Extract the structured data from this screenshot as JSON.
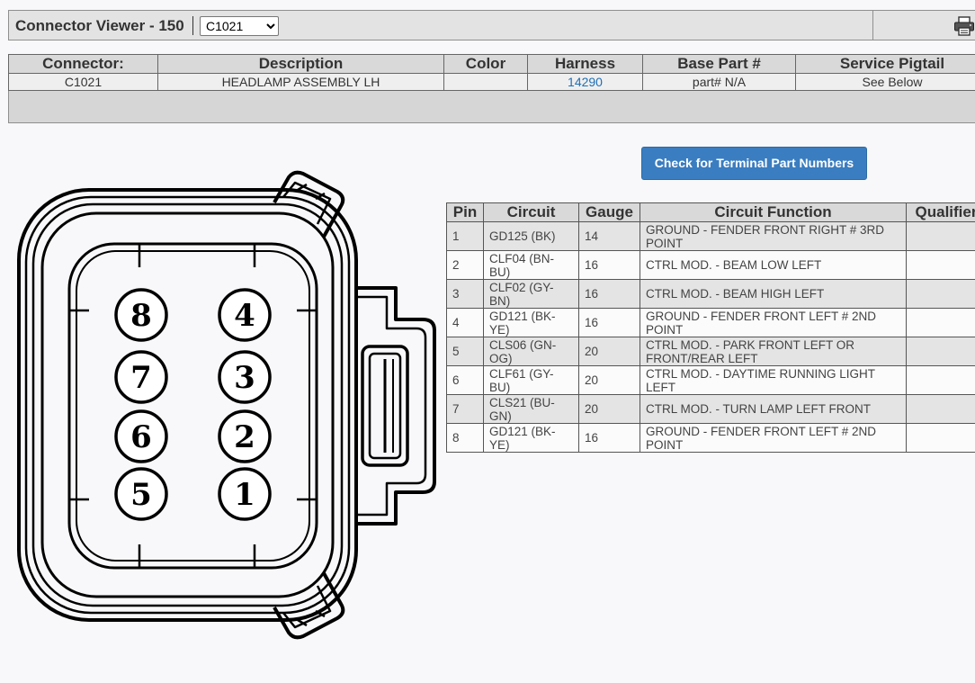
{
  "header": {
    "title": "Connector Viewer - 150",
    "connector_select": "C1021",
    "print_icon": "printer-icon"
  },
  "connector_table": {
    "headers": [
      "Connector:",
      "Description",
      "Color",
      "Harness",
      "Base Part #",
      "Service Pigtail"
    ],
    "row": {
      "connector": "C1021",
      "description": "HEADLAMP ASSEMBLY LH",
      "color": "",
      "harness": "14290",
      "base_part": "part# N/A",
      "service_pigtail": "See Below"
    }
  },
  "terminal_button": {
    "label": "Check for Terminal Part Numbers"
  },
  "pin_table": {
    "headers": [
      "Pin",
      "Circuit",
      "Gauge",
      "Circuit Function",
      "Qualifier"
    ],
    "rows": [
      {
        "pin": "1",
        "circuit": "GD125 (BK)",
        "gauge": "14",
        "function": "GROUND - FENDER FRONT RIGHT # 3RD POINT",
        "qualifier": ""
      },
      {
        "pin": "2",
        "circuit": "CLF04 (BN-BU)",
        "gauge": "16",
        "function": "CTRL MOD. - BEAM LOW LEFT",
        "qualifier": ""
      },
      {
        "pin": "3",
        "circuit": "CLF02 (GY-BN)",
        "gauge": "16",
        "function": "CTRL MOD. - BEAM HIGH LEFT",
        "qualifier": ""
      },
      {
        "pin": "4",
        "circuit": "GD121 (BK-YE)",
        "gauge": "16",
        "function": "GROUND - FENDER FRONT LEFT # 2ND POINT",
        "qualifier": ""
      },
      {
        "pin": "5",
        "circuit": "CLS06 (GN-OG)",
        "gauge": "20",
        "function": "CTRL MOD. - PARK FRONT LEFT OR FRONT/REAR LEFT",
        "qualifier": ""
      },
      {
        "pin": "6",
        "circuit": "CLF61 (GY-BU)",
        "gauge": "20",
        "function": "CTRL MOD. - DAYTIME RUNNING LIGHT LEFT",
        "qualifier": ""
      },
      {
        "pin": "7",
        "circuit": "CLS21 (BU-GN)",
        "gauge": "20",
        "function": "CTRL MOD. - TURN LAMP LEFT FRONT",
        "qualifier": ""
      },
      {
        "pin": "8",
        "circuit": "GD121 (BK-YE)",
        "gauge": "16",
        "function": "GROUND - FENDER FRONT LEFT # 2ND POINT",
        "qualifier": ""
      }
    ]
  },
  "diagram": {
    "pins": {
      "p8": "8",
      "p4": "4",
      "p7": "7",
      "p3": "3",
      "p6": "6",
      "p2": "2",
      "p5": "5",
      "p1": "1"
    }
  }
}
